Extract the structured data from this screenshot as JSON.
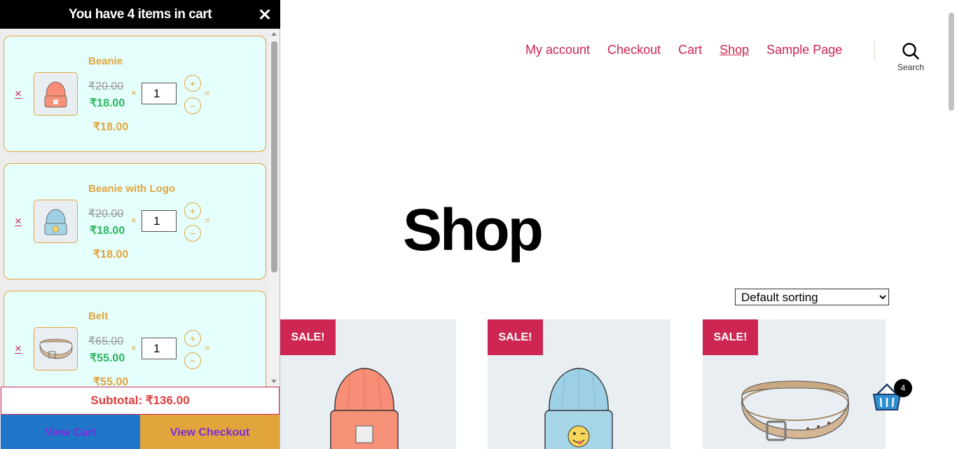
{
  "nav": {
    "items": [
      {
        "label": "My account"
      },
      {
        "label": "Checkout"
      },
      {
        "label": "Cart"
      },
      {
        "label": "Shop"
      },
      {
        "label": "Sample Page"
      }
    ],
    "search_label": "Search"
  },
  "main": {
    "title": "Shop",
    "sorting": {
      "selected": "Default sorting",
      "options": [
        "Default sorting"
      ]
    },
    "products": [
      {
        "badge": "SALE!",
        "icon": "beanie-icon"
      },
      {
        "badge": "SALE!",
        "icon": "beanie-with-logo-icon"
      },
      {
        "badge": "SALE!",
        "icon": "belt-icon"
      }
    ],
    "mini_cart_count": "4"
  },
  "sidecart": {
    "header": "You have 4 items in cart",
    "items": [
      {
        "remove": "×",
        "name": "Beanie",
        "old_price": "₹20.00",
        "price": "₹18.00",
        "times": "×",
        "qty": "1",
        "plus": "+",
        "minus": "−",
        "eq": "=",
        "line_total": "₹18.00"
      },
      {
        "remove": "×",
        "name": "Beanie with Logo",
        "old_price": "₹20.00",
        "price": "₹18.00",
        "times": "×",
        "qty": "1",
        "plus": "+",
        "minus": "−",
        "eq": "=",
        "line_total": "₹18.00"
      },
      {
        "remove": "×",
        "name": "Belt",
        "old_price": "₹65.00",
        "price": "₹55.00",
        "times": "×",
        "qty": "1",
        "plus": "+",
        "minus": "−",
        "eq": "=",
        "line_total": "₹55.00"
      }
    ],
    "subtotal": "Subtotal: ₹136.00",
    "view_cart": "View Cart",
    "view_checkout": "View Checkout"
  },
  "colors": {
    "accent": "#cd2653",
    "cart_item_bg": "#e5fffc",
    "cart_border": "#e2a53c",
    "price_green": "#2db55d",
    "view_cart_bg": "#2077c9",
    "view_checkout_bg": "#e2a53c"
  }
}
